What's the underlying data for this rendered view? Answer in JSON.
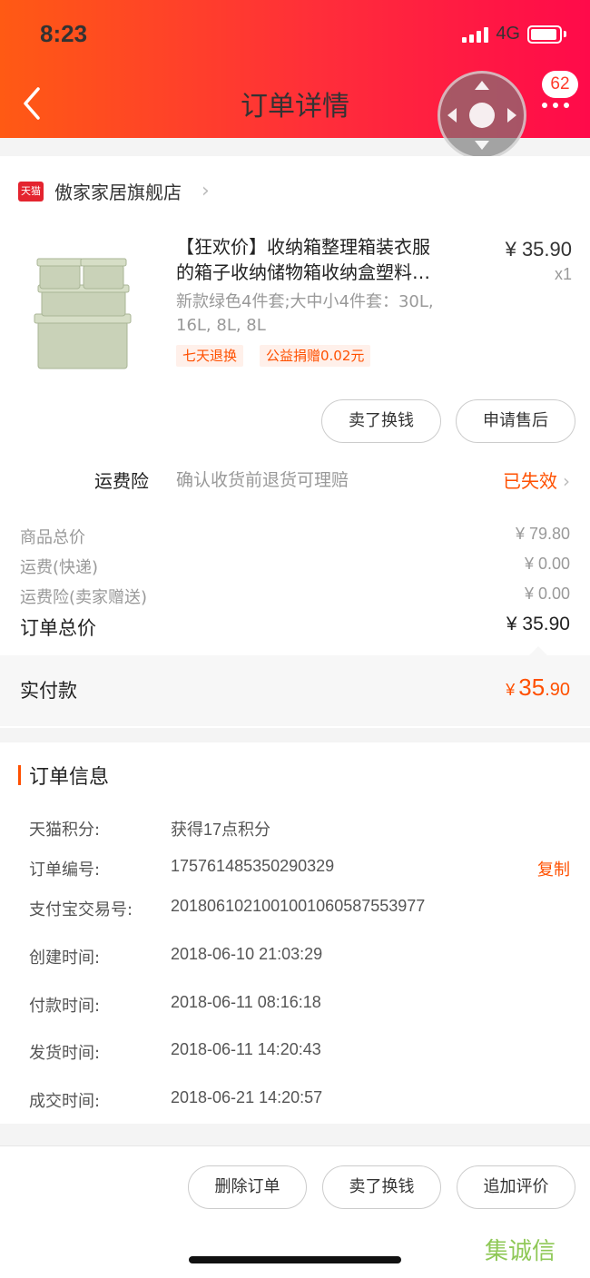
{
  "status": {
    "time": "8:23",
    "network": "4G"
  },
  "header": {
    "title": "订单详情",
    "badge": "62"
  },
  "shop": {
    "logo_text": "天猫",
    "name": "傲家家居旗舰店"
  },
  "product": {
    "title_line1": "【狂欢价】收纳箱整理箱装衣服",
    "title_line2": "的箱子收纳储物箱收纳盒塑料…",
    "spec_line1": "新款绿色4件套;大中小4件套：30L,",
    "spec_line2": "16L, 8L, 8L",
    "price": "¥ 35.90",
    "quantity": "x1",
    "tags": [
      "七天退换",
      "公益捐赠0.02元"
    ],
    "colors": {
      "box": "#c9d2b8",
      "box_dark": "#a9b596"
    }
  },
  "product_actions": {
    "sell": "卖了换钱",
    "after_sale": "申请售后"
  },
  "insurance": {
    "label": "运费险",
    "desc": "确认收货前退货可理赔",
    "status": "已失效"
  },
  "fees": [
    {
      "label": "商品总价",
      "value": "¥ 79.80"
    },
    {
      "label": "运费(快递)",
      "value": "¥ 0.00"
    },
    {
      "label": "运费险(卖家赠送)",
      "value": "¥ 0.00"
    }
  ],
  "order_total": {
    "label": "订单总价",
    "value": "¥ 35.90"
  },
  "paid": {
    "label": "实付款",
    "currency": "¥",
    "integer": "35",
    "decimal": ".90"
  },
  "order_info": {
    "title": "订单信息",
    "copy_label": "复制",
    "rows": [
      {
        "label": "天猫积分:",
        "value": "获得17点积分"
      },
      {
        "label": "订单编号:",
        "value": "175761485350290329"
      },
      {
        "label": "支付宝交易号:",
        "value": "2018061021001001060587553977"
      },
      {
        "label": "创建时间:",
        "value": "2018-06-10 21:03:29"
      },
      {
        "label": "付款时间:",
        "value": "2018-06-11 08:16:18"
      },
      {
        "label": "发货时间:",
        "value": "2018-06-11 14:20:43"
      },
      {
        "label": "成交时间:",
        "value": "2018-06-21 14:20:57"
      }
    ]
  },
  "bottom_actions": {
    "delete": "删除订单",
    "sell": "卖了换钱",
    "review": "追加评价"
  },
  "watermark": "集诚信",
  "theme": {
    "accent": "#ff5000",
    "header_start": "#ff5a14",
    "header_end": "#ff0a4a"
  }
}
